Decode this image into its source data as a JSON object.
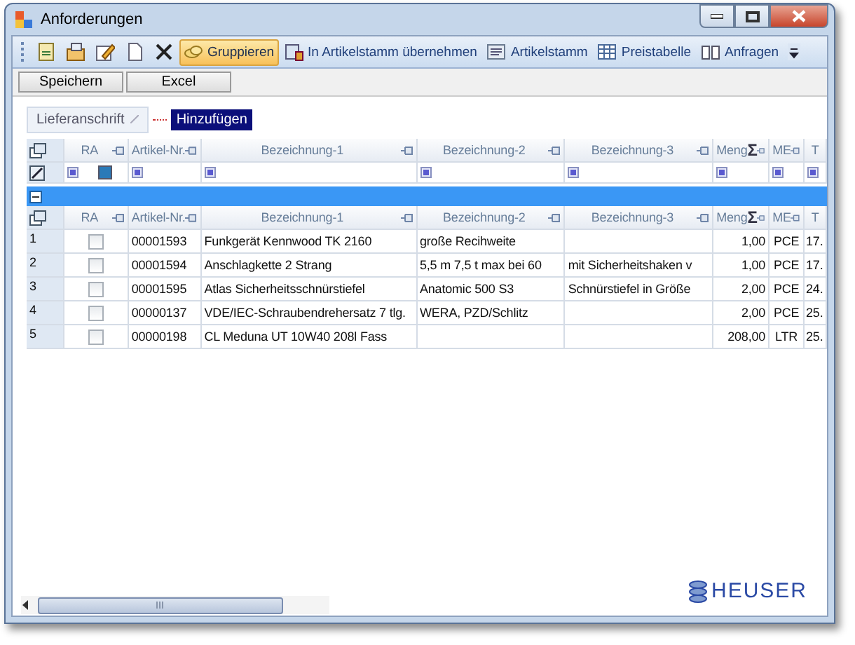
{
  "window": {
    "title": "Anforderungen"
  },
  "toolbar": [
    {
      "kind": "icon",
      "selected": false
    },
    {
      "kind": "icon",
      "selected": false
    },
    {
      "kind": "icon",
      "selected": false
    },
    {
      "kind": "icon",
      "selected": false
    },
    {
      "kind": "icon",
      "selected": false
    },
    {
      "kind": "labeled",
      "label": "Gruppieren",
      "selected": true
    },
    {
      "kind": "labeled",
      "label": "In Artikelstamm übernehmen",
      "selected": false
    },
    {
      "kind": "labeled",
      "label": "Artikelstamm",
      "selected": false
    },
    {
      "kind": "labeled",
      "label": "Preistabelle",
      "selected": false
    },
    {
      "kind": "labeled",
      "label": "Anfragen",
      "selected": false
    }
  ],
  "buttons": [
    "Speichern",
    "Excel"
  ],
  "group_by": {
    "field": "Lieferanschrift",
    "action": "Hinzufügen"
  },
  "columns": [
    {
      "label": "RA",
      "pinned": true
    },
    {
      "label": "Artikel-Nr.",
      "pinned": true
    },
    {
      "label": "Bezeichnung-1",
      "pinned": true
    },
    {
      "label": "Bezeichnung-2",
      "pinned": true
    },
    {
      "label": "Bezeichnung-3",
      "pinned": true
    },
    {
      "label": "Meng",
      "pinned": true,
      "sum": "Σ"
    },
    {
      "label": "ME",
      "pinned": true
    },
    {
      "label": "T",
      "pinned": false
    }
  ],
  "group_columns": [
    {
      "label": "RA",
      "pinned": true
    },
    {
      "label": "Artikel-Nr.",
      "pinned": true
    },
    {
      "label": "Bezeichnung-1",
      "pinned": true
    },
    {
      "label": "Bezeichnung-2",
      "pinned": true
    },
    {
      "label": "Bezeichnung-3",
      "pinned": true
    },
    {
      "label": "Meng",
      "pinned": true,
      "sum": "Σ"
    },
    {
      "label": "ME",
      "pinned": true
    },
    {
      "label": "T",
      "pinned": false
    }
  ],
  "group": {
    "expanded": true
  },
  "rows": [
    {
      "number": "1",
      "ra": false,
      "cells": [
        "00001593",
        "Funkgerät Kennwood TK 2160",
        "große Recihweite",
        "",
        "1,00",
        "PCE",
        "17."
      ]
    },
    {
      "number": "2",
      "ra": false,
      "cells": [
        "00001594",
        "Anschlagkette 2 Strang",
        "5,5 m 7,5 t max bei 60",
        "mit Sicherheitshaken v",
        "1,00",
        "PCE",
        "17."
      ]
    },
    {
      "number": "3",
      "ra": false,
      "cells": [
        "00001595",
        "Atlas Sicherheitsschnürstiefel",
        "Anatomic 500 S3",
        "Schnürstiefel in Größe",
        "2,00",
        "PCE",
        "24."
      ]
    },
    {
      "number": "4",
      "ra": false,
      "cells": [
        "00000137",
        "VDE/IEC-Schraubendrehersatz 7 tlg.",
        "WERA, PZD/Schlitz",
        "",
        "2,00",
        "PCE",
        "25."
      ]
    },
    {
      "number": "5",
      "ra": false,
      "cells": [
        "00000198",
        "CL Meduna UT 10W40 208l Fass",
        "",
        "",
        "208,00",
        "LTR",
        "25."
      ]
    }
  ],
  "logo": {
    "text": "HEUSER"
  }
}
